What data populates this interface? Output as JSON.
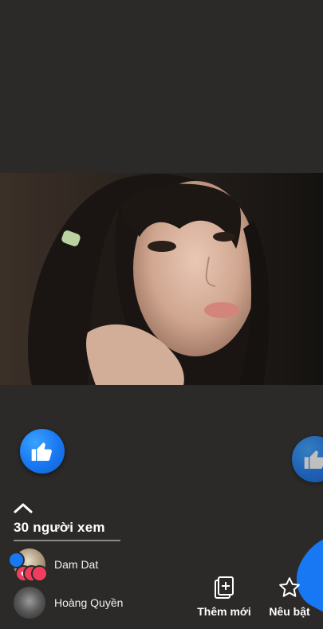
{
  "live": {
    "viewers_label": "30 người xem",
    "viewers": [
      {
        "name": "Dam Dat"
      },
      {
        "name": "Hoàng Quyền"
      }
    ]
  },
  "actions": {
    "add_new_label": "Thêm mới",
    "feature_label": "Nêu bật"
  },
  "icons": {
    "like": "thumbs-up-icon",
    "chevron": "chevron-up-icon",
    "add": "add-card-icon",
    "star": "star-icon",
    "love": "heart-icon"
  },
  "colors": {
    "background": "#2b2a28",
    "brand_blue": "#1877f2",
    "love_red": "#f03d5b"
  }
}
